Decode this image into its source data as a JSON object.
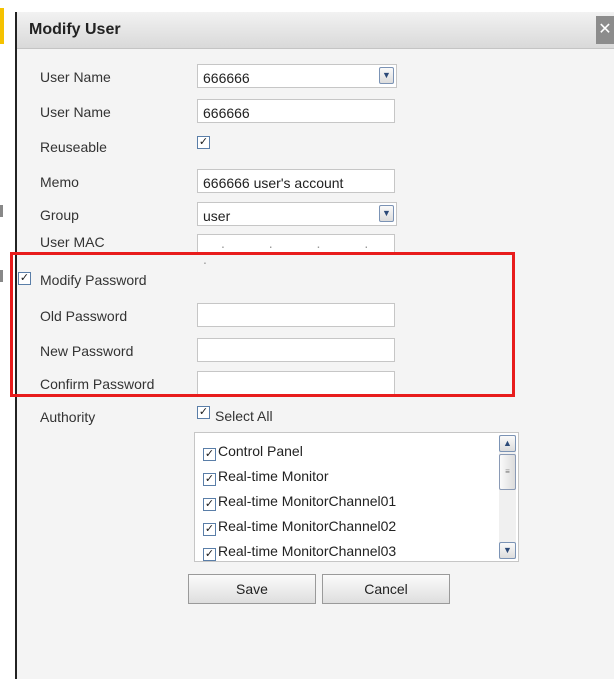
{
  "dialog": {
    "title": "Modify User",
    "close_glyph": "✕"
  },
  "form": {
    "user_name_select_label": "User Name",
    "user_name_select_value": "666666",
    "user_name_label": "User Name",
    "user_name_value": "666666",
    "reuseable_label": "Reuseable",
    "reuseable_checked": true,
    "memo_label": "Memo",
    "memo_value": "666666 user's account",
    "group_label": "Group",
    "group_value": "user",
    "user_mac_label": "User MAC",
    "user_mac_value": ". . . . ."
  },
  "password": {
    "modify_label": "Modify Password",
    "modify_checked": true,
    "old_label": "Old Password",
    "old_value": "",
    "new_label": "New Password",
    "new_value": "",
    "confirm_label": "Confirm Password",
    "confirm_value": ""
  },
  "authority": {
    "label": "Authority",
    "select_all_label": "Select All",
    "select_all_checked": true,
    "items": [
      {
        "label": "Control Panel",
        "checked": true
      },
      {
        "label": "Real-time Monitor",
        "checked": true
      },
      {
        "label": "Real-time MonitorChannel01",
        "checked": true
      },
      {
        "label": "Real-time MonitorChannel02",
        "checked": true
      },
      {
        "label": "Real-time MonitorChannel03",
        "checked": true
      }
    ]
  },
  "buttons": {
    "save": "Save",
    "cancel": "Cancel"
  },
  "icons": {
    "checkbox_checked": "checkmark-icon",
    "dropdown": "chevron-down-icon",
    "scroll_up": "chevron-up-icon",
    "scroll_down": "chevron-down-icon",
    "close": "close-icon"
  },
  "colors": {
    "highlight_box": "#e81c1c",
    "dialog_bg": "#f4f4f4",
    "titlebar": "#d9d9d9"
  }
}
